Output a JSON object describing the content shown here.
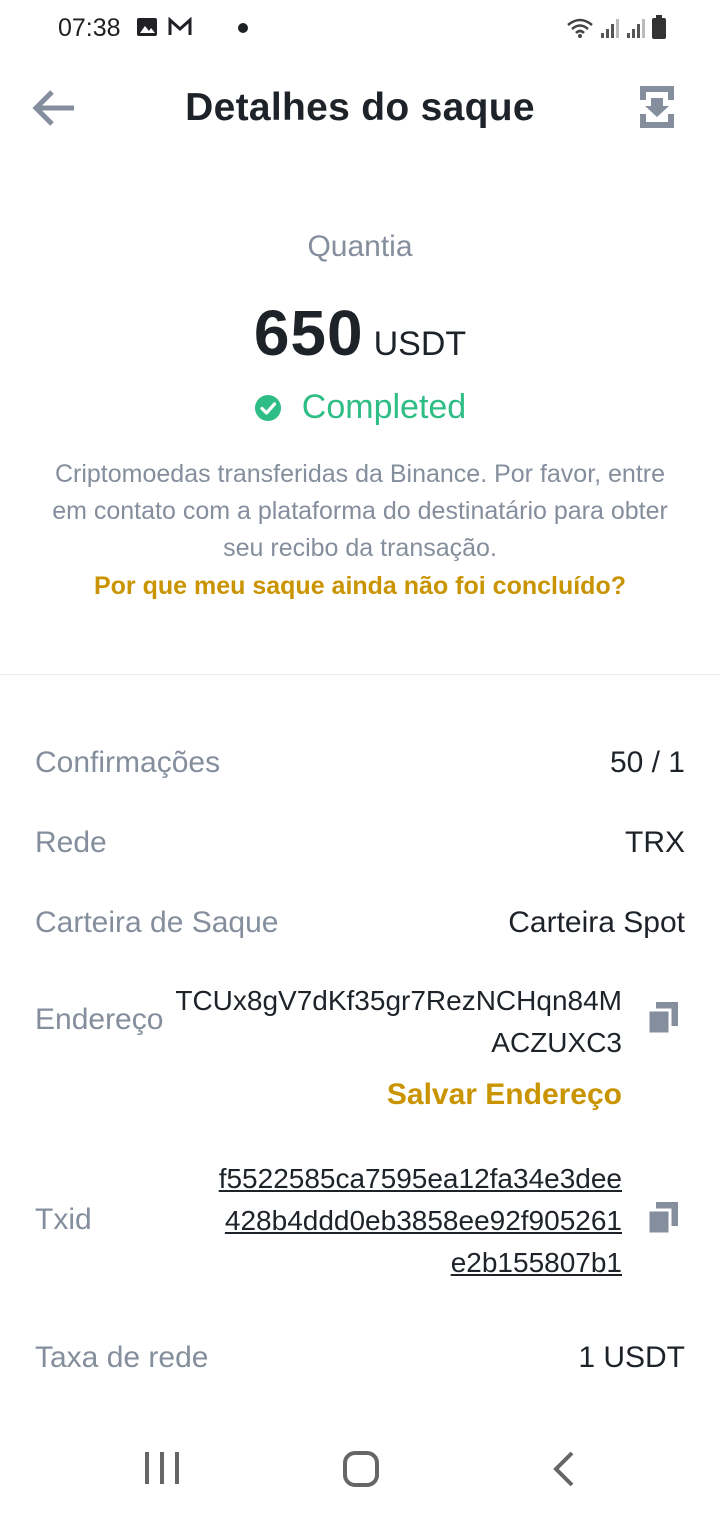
{
  "status_bar": {
    "time": "07:38"
  },
  "header": {
    "title": "Detalhes do saque"
  },
  "amount": {
    "label": "Quantia",
    "value": "650",
    "unit": "USDT"
  },
  "status": {
    "text": "Completed",
    "color": "#2ebd85"
  },
  "description": "Criptomoedas transferidas da Binance. Por favor, entre em contato com a plataforma do destinatário para obter seu recibo da transação.",
  "help_link": "Por que meu saque ainda não foi concluído?",
  "details": {
    "confirmations": {
      "label": "Confirmações",
      "value": "50 / 1"
    },
    "network": {
      "label": "Rede",
      "value": "TRX"
    },
    "wallet": {
      "label": "Carteira de Saque",
      "value": "Carteira Spot"
    },
    "address": {
      "label": "Endereço",
      "value": "TCUx8gV7dKf35gr7RezNCHqn84MACZUXC3",
      "save_label": "Salvar Endereço"
    },
    "txid": {
      "label": "Txid",
      "lines": [
        "f5522585ca7595ea12fa34e3dee",
        "428b4ddd0eb3858ee92f905261",
        "e2b155807b1"
      ]
    },
    "fee": {
      "label": "Taxa de rede",
      "value": "1 USDT"
    }
  },
  "colors": {
    "accent": "#c99400",
    "muted": "#848e9c",
    "text": "#1e2329",
    "success": "#2ebd85"
  },
  "icons": [
    "back-arrow-icon",
    "download-icon",
    "check-circle-icon",
    "copy-icon",
    "recent-apps-icon",
    "home-icon",
    "nav-back-icon"
  ]
}
